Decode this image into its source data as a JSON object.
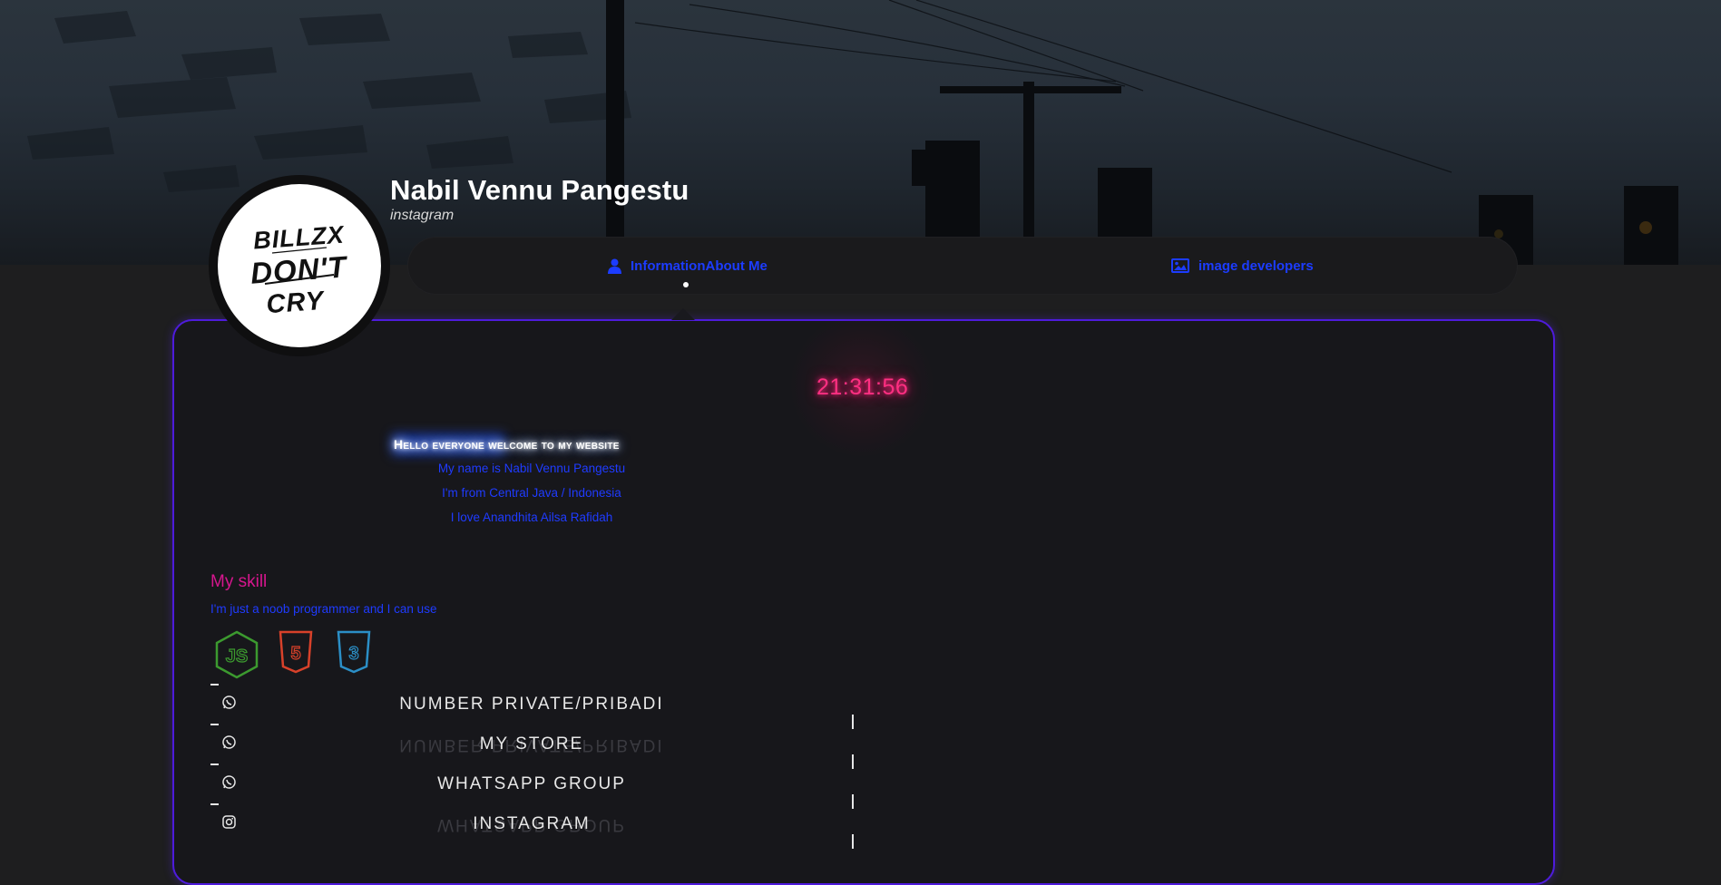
{
  "profile": {
    "name": "Nabil Vennu Pangestu",
    "subtitle": "instagram",
    "avatar_text": [
      "BILLZX",
      "DON'T",
      "CRY"
    ]
  },
  "tabs": [
    {
      "label": "InformationAbout Me",
      "icon": "user-icon",
      "active": true
    },
    {
      "label": "image developers",
      "icon": "image-icon",
      "active": false
    }
  ],
  "clock": "21:31:56",
  "intro": {
    "welcome": "Hello everyone welcome to my website",
    "lines": [
      "My name is Nabil Vennu Pangestu",
      "I'm from Central Java / Indonesia",
      "I love Anandhita Ailsa Rafidah"
    ]
  },
  "skills": {
    "title": "My skill",
    "subtitle": "I'm just a noob programmer and I can use",
    "icons": [
      "nodejs-icon",
      "html5-icon",
      "css3-icon"
    ]
  },
  "links": [
    {
      "label": "NUMBER PRIVATE/PRIBADI",
      "icon": "whatsapp-icon"
    },
    {
      "label": "MY STORE",
      "icon": "whatsapp-icon"
    },
    {
      "label": "WHATSAPP GROUP",
      "icon": "whatsapp-icon"
    },
    {
      "label": "INSTAGRAM",
      "icon": "instagram-icon"
    }
  ],
  "colors": {
    "accent_blue": "#1f3bff",
    "panel_border": "#4e1bdc",
    "clock_pink": "#ff2f82",
    "skill_title": "#d6168e"
  }
}
